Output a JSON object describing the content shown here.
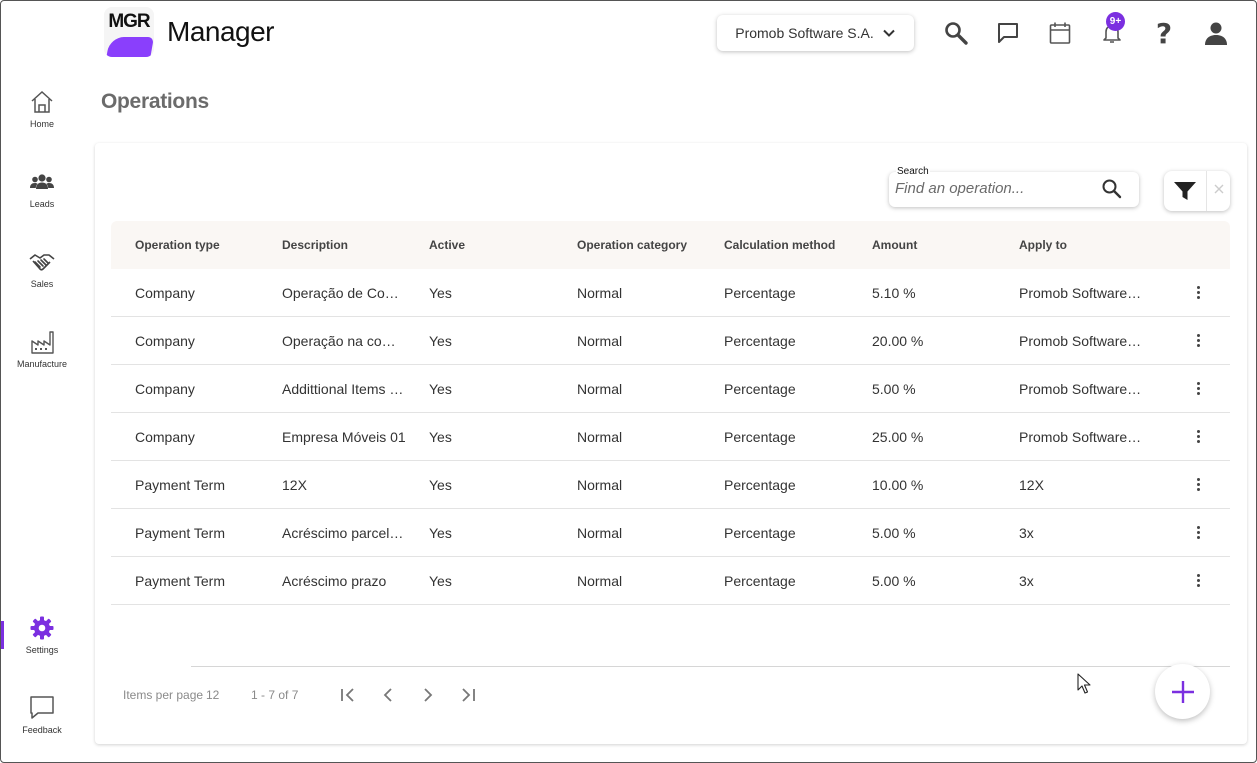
{
  "app": {
    "logo_text": "MGR",
    "name": "Manager"
  },
  "header": {
    "company": "Promob Software S.A.",
    "notifications_badge": "9+",
    "icons": [
      "search-icon",
      "chat-icon",
      "calendar-icon",
      "bell-icon",
      "help-icon",
      "user-icon"
    ],
    "help_glyph": "?"
  },
  "sidebar": {
    "items": [
      {
        "label": "Home",
        "icon": "home-icon"
      },
      {
        "label": "Leads",
        "icon": "people-icon"
      },
      {
        "label": "Sales",
        "icon": "handshake-icon"
      },
      {
        "label": "Manufacture",
        "icon": "factory-icon"
      },
      {
        "label": "Settings",
        "icon": "gear-icon",
        "active": true
      },
      {
        "label": "Feedback",
        "icon": "feedback-icon"
      }
    ],
    "accent": "#7b2fe0"
  },
  "page": {
    "title": "Operations"
  },
  "search": {
    "label": "Search",
    "placeholder": "Find an operation..."
  },
  "table": {
    "columns": [
      "Operation type",
      "Description",
      "Active",
      "Operation category",
      "Calculation method",
      "Amount",
      "Apply to"
    ],
    "rows": [
      [
        "Company",
        "Operação de Compra",
        "Yes",
        "Normal",
        "Percentage",
        "5.10 %",
        "Promob Software S.A."
      ],
      [
        "Company",
        "Operação na compra",
        "Yes",
        "Normal",
        "Percentage",
        "20.00 %",
        "Promob Software S.A."
      ],
      [
        "Company",
        "Addittional Items Importados",
        "Yes",
        "Normal",
        "Percentage",
        "5.00 %",
        "Promob Software S.A."
      ],
      [
        "Company",
        "Empresa Móveis 01",
        "Yes",
        "Normal",
        "Percentage",
        "25.00 %",
        "Promob Software S.A."
      ],
      [
        "Payment Term",
        "12X",
        "Yes",
        "Normal",
        "Percentage",
        "10.00 %",
        "12X"
      ],
      [
        "Payment Term",
        "Acréscimo parcelado",
        "Yes",
        "Normal",
        "Percentage",
        "5.00 %",
        "3x"
      ],
      [
        "Payment Term",
        "Acréscimo prazo",
        "Yes",
        "Normal",
        "Percentage",
        "5.00 %",
        "3x"
      ]
    ]
  },
  "pagination": {
    "items_per_page_label": "Items per page",
    "items_per_page": "12",
    "range": "1 - 7 of 7"
  },
  "colors": {
    "accent": "#7b2fe0",
    "header_bg": "#faf7f4"
  }
}
